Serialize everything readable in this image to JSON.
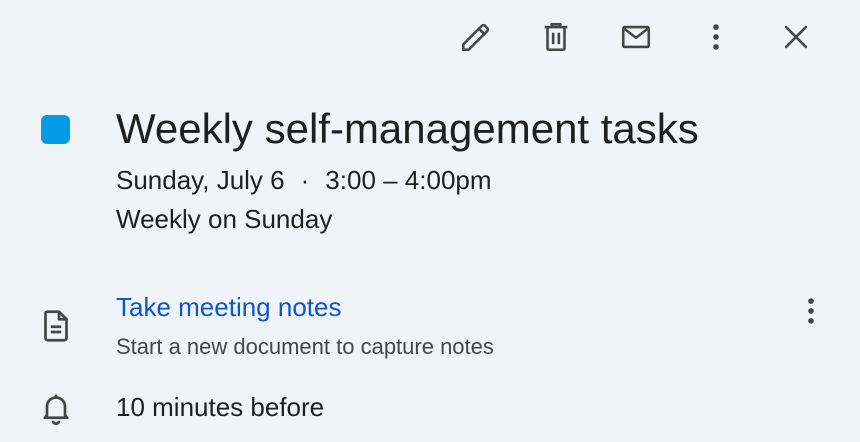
{
  "toolbar": {
    "edit_icon": "pencil-icon",
    "delete_icon": "trash-icon",
    "email_icon": "mail-icon",
    "more_icon": "more-vert-icon",
    "close_icon": "close-icon"
  },
  "event": {
    "color": "#039be5",
    "title": "Weekly self-management tasks",
    "date": "Sunday, July 6",
    "separator": "·",
    "time": "3:00 – 4:00pm",
    "recurrence": "Weekly on Sunday"
  },
  "notes": {
    "icon": "document-icon",
    "link_label": "Take meeting notes",
    "sublabel": "Start a new document to capture notes",
    "more_icon": "more-vert-icon"
  },
  "reminder": {
    "icon": "bell-icon",
    "label": "10 minutes before"
  },
  "colors": {
    "background": "#f0f3f8",
    "link": "#0b57d0",
    "text": "#1f1f1f",
    "muted": "#444746"
  }
}
